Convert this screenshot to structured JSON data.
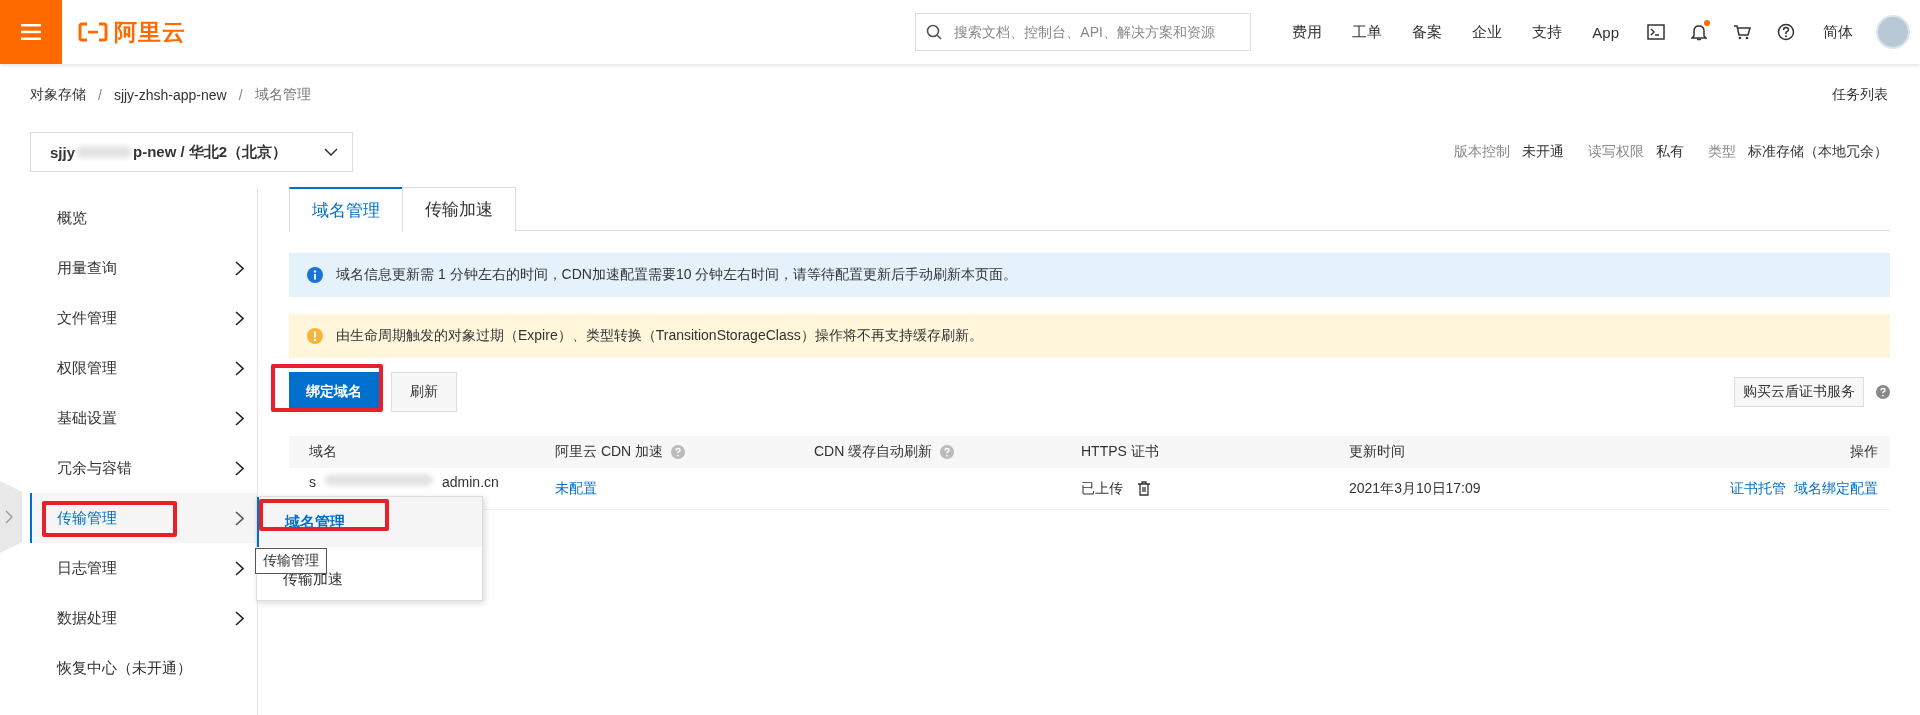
{
  "header": {
    "logo": "阿里云",
    "search": {
      "placeholder": "搜索文档、控制台、API、解决方案和资源"
    },
    "nav": [
      "费用",
      "工单",
      "备案",
      "企业",
      "支持",
      "App"
    ],
    "notification": true,
    "language": "简体"
  },
  "breadcrumb_separator": "/",
  "breadcrumb": [
    {
      "label": "对象存储",
      "current": false
    },
    {
      "label": "sjjy-zhsh-app-new",
      "current": false
    },
    {
      "label": "域名管理",
      "current": true
    }
  ],
  "task_list": "任务列表",
  "bucket_selector": {
    "prefix": "sjjy",
    "suffix": "p-new / 华北2（北京）"
  },
  "bucket_info": [
    {
      "label": "版本控制",
      "value": "未开通"
    },
    {
      "label": "读写权限",
      "value": "私有"
    },
    {
      "label": "类型",
      "value": "标准存储（本地冗余）"
    }
  ],
  "sidebar": {
    "items": [
      {
        "label": "概览",
        "has_children": false,
        "selected": false,
        "highlighted": false
      },
      {
        "label": "用量查询",
        "has_children": true,
        "selected": false,
        "highlighted": false
      },
      {
        "label": "文件管理",
        "has_children": true,
        "selected": false,
        "highlighted": false
      },
      {
        "label": "权限管理",
        "has_children": true,
        "selected": false,
        "highlighted": false
      },
      {
        "label": "基础设置",
        "has_children": true,
        "selected": false,
        "highlighted": false
      },
      {
        "label": "冗余与容错",
        "has_children": true,
        "selected": false,
        "highlighted": false
      },
      {
        "label": "传输管理",
        "has_children": true,
        "selected": true,
        "highlighted": true
      },
      {
        "label": "日志管理",
        "has_children": true,
        "selected": false,
        "highlighted": false
      },
      {
        "label": "数据处理",
        "has_children": true,
        "selected": false,
        "highlighted": false
      },
      {
        "label": "恢复中心（未开通）",
        "has_children": false,
        "selected": false,
        "highlighted": false
      }
    ]
  },
  "submenu": {
    "items": [
      {
        "label": "域名管理",
        "selected": true,
        "highlighted": true
      },
      {
        "label": "传输加速",
        "selected": false,
        "highlighted": false
      }
    ],
    "tooltip": "传输管理"
  },
  "tabs": [
    {
      "label": "域名管理",
      "selected": true
    },
    {
      "label": "传输加速",
      "selected": false
    }
  ],
  "notices": [
    {
      "kind": "info",
      "text": "域名信息更新需 1 分钟左右的时间，CDN加速配置需要10 分钟左右时间，请等待配置更新后手动刷新本页面。"
    },
    {
      "kind": "warning",
      "text": "由生命周期触发的对象过期（Expire）、类型转换（TransitionStorageClass）操作将不再支持缓存刷新。"
    }
  ],
  "actions": [
    {
      "label": "绑定域名",
      "primary": true,
      "highlighted": true
    },
    {
      "label": "刷新",
      "primary": false,
      "highlighted": false
    }
  ],
  "cert_button": "购买云盾证书服务",
  "table": {
    "columns": [
      {
        "label": "域名",
        "help": false
      },
      {
        "label": "阿里云 CDN 加速",
        "help": true
      },
      {
        "label": "CDN 缓存自动刷新",
        "help": true
      },
      {
        "label": "HTTPS 证书",
        "help": false
      },
      {
        "label": "更新时间",
        "help": false
      },
      {
        "label": "操作",
        "help": false
      }
    ],
    "rows": [
      {
        "domain_prefix": "s",
        "domain_suffix": "admin.cn",
        "cdn": "未配置",
        "https": "已上传",
        "updated": "2021年3月10日17:09",
        "operations": [
          "证书托管",
          "域名绑定配置"
        ]
      }
    ]
  }
}
